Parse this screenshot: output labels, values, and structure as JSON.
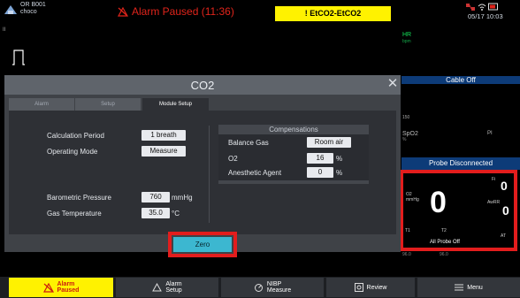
{
  "header": {
    "room": "OR B001",
    "patient": "choco",
    "alarm_paused_text": "Alarm Paused (11:36)",
    "active_alarm": "! EtCO2-EtCO2",
    "datetime": "05/17 10:03"
  },
  "waveform": {
    "lead_label": "II"
  },
  "params": {
    "hr_label": "HR",
    "hr_unit": "bpm",
    "cable_off": "Cable Off",
    "scale_150": "150",
    "spo2_label": "SpO2",
    "spo2_unit": "%",
    "pi_label": "PI",
    "probe_disconnected": "Probe Disconnected",
    "co2": {
      "fi_label": "Fi",
      "o2_label": "O2",
      "mmhg_label": "mmHg",
      "etco2_value": "0",
      "fi_value": "0",
      "awrr_label": "AwRR",
      "awrr_value": "0",
      "t1_label": "T1",
      "t2_label": "T2",
      "at_label": "AT",
      "probe_off": "All Probe Off"
    },
    "bottom_left": "96.0",
    "bottom_mid": "96.0"
  },
  "dialog": {
    "title": "CO2",
    "tabs": [
      "Alarm",
      "Setup",
      "Module Setup"
    ],
    "active_tab": "Module Setup",
    "calc_period_label": "Calculation Period",
    "calc_period_value": "1 breath",
    "operating_mode_label": "Operating Mode",
    "operating_mode_value": "Measure",
    "baro_label": "Barometric Pressure",
    "baro_value": "760",
    "baro_unit": "mmHg",
    "gas_temp_label": "Gas Temperature",
    "gas_temp_value": "35.0",
    "gas_temp_unit": "°C",
    "compensations_title": "Compensations",
    "balance_gas_label": "Balance Gas",
    "balance_gas_value": "Room air",
    "o2_label": "O2",
    "o2_value": "16",
    "o2_unit": "%",
    "anesthetic_label": "Anesthetic Agent",
    "anesthetic_value": "0",
    "anesthetic_unit": "%",
    "zero_button": "Zero"
  },
  "toolbar": {
    "alarm_paused_line1": "Alarm",
    "alarm_paused_line2": "Paused",
    "alarm_setup_line1": "Alarm",
    "alarm_setup_line2": "Setup",
    "nibp_line1": "NIBP",
    "nibp_line2": "Measure",
    "review": "Review",
    "menu": "Menu"
  },
  "colors": {
    "alarm_red": "#e0241b",
    "alarm_yellow": "#fff200",
    "zero_button": "#3cb7d0",
    "highlight_red": "#e21d1d",
    "hr_green": "#14e45a",
    "banner_blue": "#0d3b78"
  }
}
